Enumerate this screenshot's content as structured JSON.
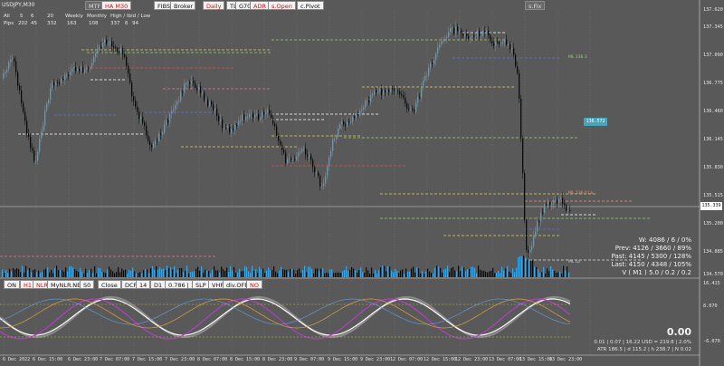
{
  "symbol": "USDJPY,M30",
  "top_buttons": {
    "mtf": "MTF",
    "ha": "HA M30",
    "fibs": "FIBS OFF",
    "broker": "Broker",
    "daily": "Daily",
    "tl": "TL",
    "g70": "G70",
    "adr": "ADR",
    "sopen": "s.Open",
    "cpivot": "c.Pivot",
    "sfix": "s.Fix"
  },
  "adr_table": {
    "header": [
      "All",
      "5",
      "6",
      "20",
      "Weekly",
      "Monthly",
      "High / Ibid / Low"
    ],
    "row": [
      "Pips",
      "202",
      "45",
      "332",
      "163",
      "108",
      "337",
      "6",
      "94"
    ]
  },
  "price_axis": [
    "137.345",
    "137.090",
    "136.775",
    "136.460",
    "136.145",
    "135.830",
    "135.515",
    "135.200",
    "134.885",
    "134.570"
  ],
  "price_axis_top": "137.620",
  "osc_axis": [
    "16.415",
    "8.070",
    "-6.070"
  ],
  "price_tags": {
    "current": "135.339",
    "mid": "136.572",
    "pivot": "135.1165"
  },
  "chart_labels": {
    "ma_level": "ML 136.3",
    "mid_label": "ML 136.0 Lo",
    "low_label": "ML Lo"
  },
  "time_axis": [
    "6 Dec 2022",
    "6 Dec 15:00",
    "6 Dec 23:00",
    "7 Dec 07:00",
    "7 Dec 15:00",
    "7 Dec 23:00",
    "8 Dec 07:00",
    "8 Dec 15:00",
    "8 Dec 23:00",
    "9 Dec 07:00",
    "9 Dec 15:00",
    "9 Dec 23:00",
    "12 Dec 07:00",
    "12 Dec 15:00",
    "12 Dec 23:00",
    "13 Dec 07:00",
    "13 Dec 15:00",
    "13 Dec 23:00"
  ],
  "bottom_buttons": {
    "on": "ON",
    "h1": "H1",
    "nlr": "NLR",
    "mynlr": "MyNLR.NET",
    "s0": "S0",
    "close": "Close",
    "dcp": "DCP",
    "n14": "14",
    "d1": "D1",
    "fib": "0.786 | 10",
    "slp": "SLP",
    "vhf": "VHF",
    "divoff": "div.OFF",
    "no": "NO"
  },
  "stats": {
    "w": "W: 4086 / 6 / 0%",
    "prev": "Prev: 4126 / 3660 / 89%",
    "past": "Past: 4145 / 5300 / 128%",
    "last": "Last: 4150 / 4348 / 105%",
    "vm": "V ( M1 ) 5.0 / 0.2 / 0.2"
  },
  "osc_stats": {
    "big": "0.00",
    "line1": "0.01  |  0.07  |  16.22 USD = 219.8  |  2.0%",
    "line2": "ATR 186.5  |  d 115.2  |  h 238.7  |  N 0.02"
  },
  "colors": {
    "bg": "#595959",
    "bull": "#3aa6e8",
    "bear": "#0a0a0a",
    "grid": "#7a7a7a",
    "tag": "#7fd8e0"
  }
}
